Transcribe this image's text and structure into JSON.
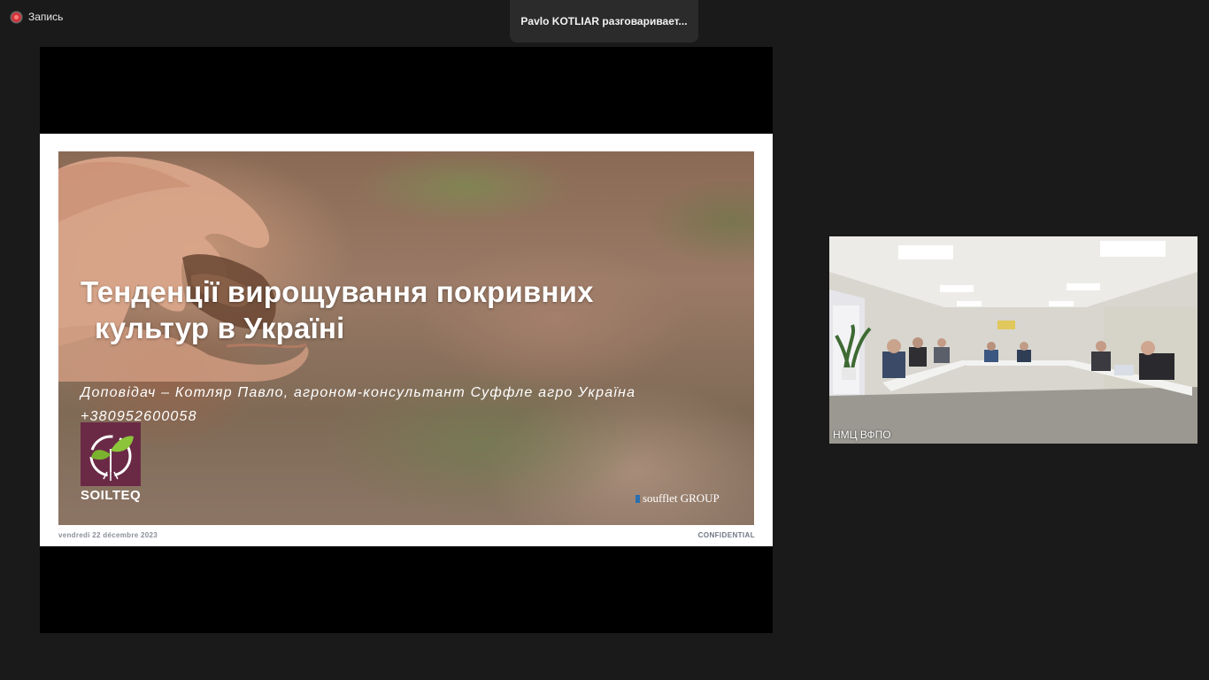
{
  "recording": {
    "label": "Запись",
    "icon": "record-dot-icon"
  },
  "toast": {
    "text": "Pavlo KOTLIAR разговаривает..."
  },
  "slide": {
    "title_line1": "Тенденції вирощування покривних",
    "title_line2": "культур в Україні",
    "subtitle": "Доповідач – Котляр Павло, агроном-консультант Суффле агро Україна",
    "phone": "+380952600058",
    "logo_text": "SOILTEQ",
    "partner": "soufflet GROUP",
    "date": "vendredi 22 décembre 2023",
    "confidential": "CONFIDENTIAL"
  },
  "participant": {
    "name": "НМЦ ВФПО"
  },
  "colors": {
    "background": "#1a1a1a",
    "record_red": "#d0363a",
    "soilteq_purple": "#6a2a46",
    "soufflet_blue": "#2a6fb0"
  }
}
